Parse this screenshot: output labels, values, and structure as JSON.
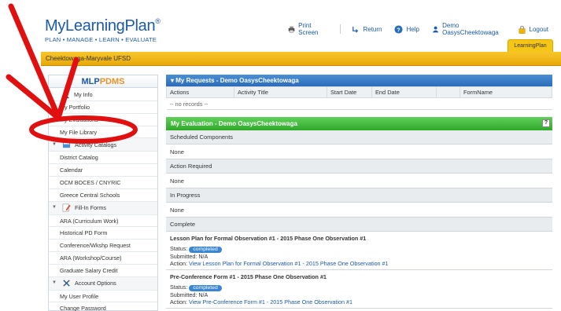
{
  "header": {
    "logo_main": "MyLearningPlan",
    "logo_reg": "®",
    "logo_tagline": "PLAN • MANAGE • LEARN • EVALUATE",
    "links": {
      "print": "Print Screen",
      "return": "Return",
      "help": "Help",
      "user": "Demo OasysCheektowaga",
      "logout": "Logout"
    },
    "tab_label": "LearningPlan"
  },
  "district": "Cheektowaga-Maryvale UFSD",
  "sidebar": {
    "brand_a": "MLP",
    "brand_b": "PDMS",
    "my_info": "My Info",
    "items_info": [
      "My Portfolio",
      "My Evaluations",
      "My File Library"
    ],
    "activity_catalogs": "Activity Catalogs",
    "items_catalog": [
      "District Catalog",
      "Calendar",
      "OCM BOCES / CNYRIC",
      "Greece Central Schools"
    ],
    "fill_in_forms": "Fill-In Forms",
    "items_forms": [
      "ARA (Curriculum Work)",
      "Historical PD Form",
      "Conference/Wkshp Request",
      "ARA (Workshop/Course)",
      "Graduate Salary Credit"
    ],
    "account_options": "Account Options",
    "items_account": [
      "My User Profile",
      "Change Password"
    ]
  },
  "requests": {
    "title": "My Requests - Demo OasysCheektowaga",
    "columns": [
      "Actions",
      "Activity Title",
      "Start Date",
      "End Date",
      "FormName"
    ],
    "empty": "-- no records --"
  },
  "evaluation": {
    "title": "My Evaluation - Demo OasysCheektowaga",
    "help": "?",
    "scheduled": "Scheduled Components",
    "scheduled_value": "None",
    "action_required": "Action Required",
    "action_value": "None",
    "in_progress": "In Progress",
    "progress_value": "None",
    "complete": "Complete",
    "items": [
      {
        "title": "Lesson Plan for Formal Observation #1 - 2015 Phase One Observation #1",
        "status_label": "Status:",
        "status": "completed",
        "submitted": "Submitted: N/A",
        "action_label": "Action:",
        "action": "View Lesson Plan for Formal Observation #1 - 2015 Phase One Observation #1"
      },
      {
        "title": "Pre-Conference Form #1 - 2015 Phase One Observation #1",
        "status_label": "Status:",
        "status": "completed",
        "submitted": "Submitted: N/A",
        "action_label": "Action:",
        "action": "View Pre-Conference Form #1 - 2015 Phase One Observation #1"
      }
    ]
  },
  "colors": {
    "brand_blue": "#1c5aa8",
    "district_yellow": "#f5c518",
    "header_blue": "#2b6cb8",
    "eval_green": "#3db838",
    "annotation_red": "#e01010"
  }
}
